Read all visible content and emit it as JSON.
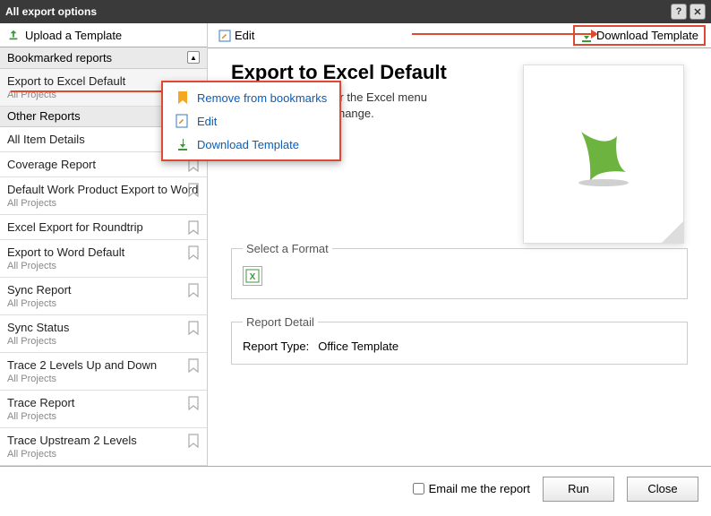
{
  "window_title": "All export options",
  "upload_label": "Upload a Template",
  "sections": {
    "bookmarked_header": "Bookmarked reports",
    "other_header": "Other Reports"
  },
  "bookmarked": [
    {
      "name": "Export to Excel Default",
      "sub": "All Projects"
    }
  ],
  "other": [
    {
      "name": "All Item Details",
      "sub": ""
    },
    {
      "name": "Coverage Report",
      "sub": ""
    },
    {
      "name": "Default Work Product Export to Word",
      "sub": "All Projects"
    },
    {
      "name": "Excel Export for Roundtrip",
      "sub": ""
    },
    {
      "name": "Export to Word Default",
      "sub": "All Projects"
    },
    {
      "name": "Sync Report",
      "sub": "All Projects"
    },
    {
      "name": "Sync Status",
      "sub": "All Projects"
    },
    {
      "name": "Trace 2 Levels Up and Down",
      "sub": "All Projects"
    },
    {
      "name": "Trace Report",
      "sub": "All Projects"
    },
    {
      "name": "Trace Upstream 2 Levels",
      "sub": "All Projects"
    }
  ],
  "toolbar": {
    "edit_label": "Edit",
    "download_label": "Download Template"
  },
  "context_menu": {
    "remove": "Remove from bookmarks",
    "edit": "Edit",
    "download": "Download Template"
  },
  "detail": {
    "title": "Export to Excel Default",
    "description_partial": "ed as the template for the Excel menu option. Edit and re- change.",
    "format_legend": "Select a Format",
    "report_legend": "Report Detail",
    "report_type_label": "Report Type:",
    "report_type_value": "Office Template"
  },
  "footer": {
    "email_label": "Email me the report",
    "run": "Run",
    "close": "Close"
  }
}
